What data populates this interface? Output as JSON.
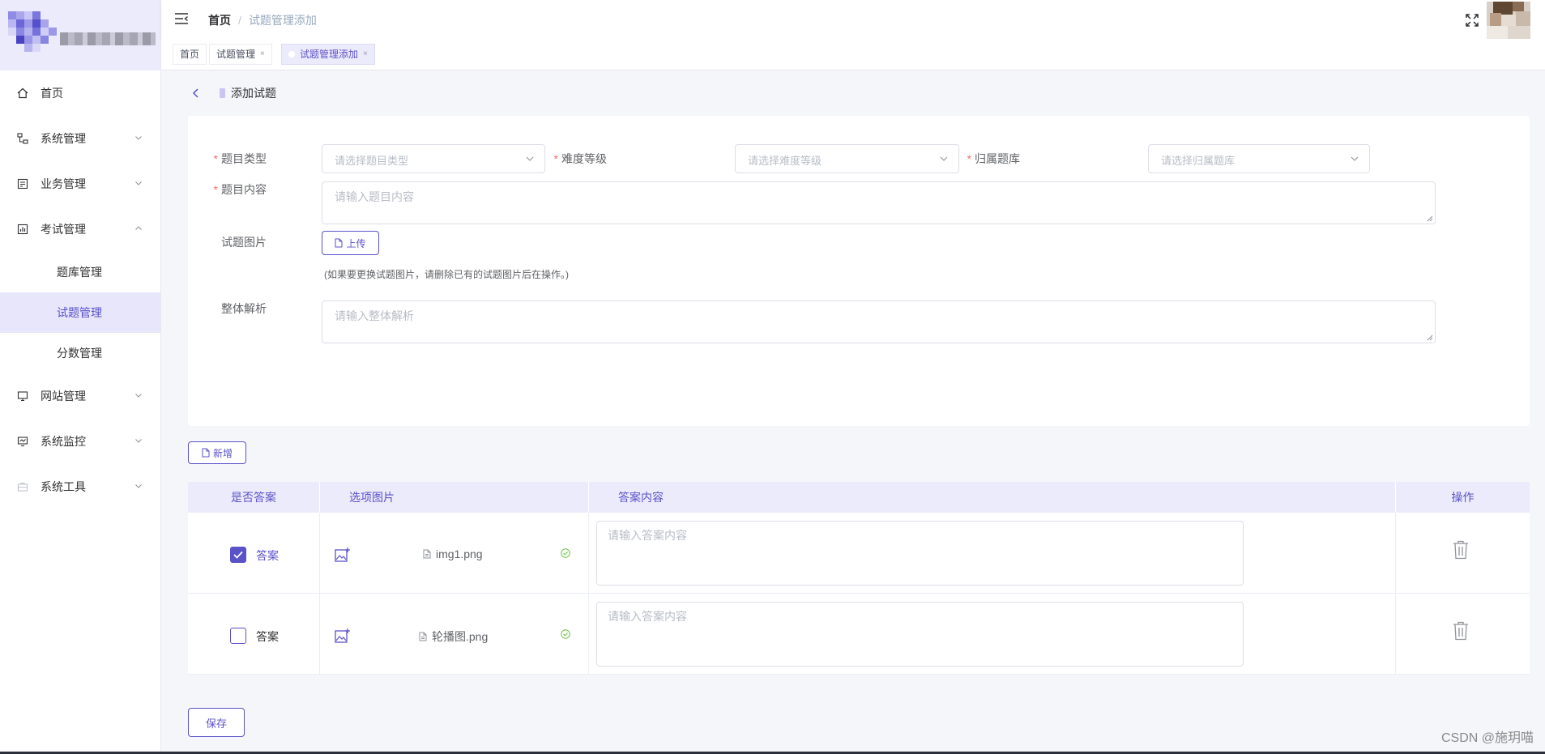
{
  "colors": {
    "accent": "#5a52c9",
    "accent_light": "#ecebfb",
    "required": "#f56c6c",
    "success": "#67c23a"
  },
  "sidebar": {
    "items": [
      {
        "label": "首页",
        "icon": "home-icon"
      },
      {
        "label": "系统管理",
        "icon": "system-settings-icon"
      },
      {
        "label": "业务管理",
        "icon": "business-icon"
      },
      {
        "label": "考试管理",
        "icon": "exam-icon",
        "expanded": true,
        "children": [
          {
            "label": "题库管理"
          },
          {
            "label": "试题管理",
            "active": true
          },
          {
            "label": "分数管理"
          }
        ]
      },
      {
        "label": "网站管理",
        "icon": "website-icon"
      },
      {
        "label": "系统监控",
        "icon": "monitor-icon"
      },
      {
        "label": "系统工具",
        "icon": "tools-icon"
      }
    ]
  },
  "header": {
    "breadcrumb": {
      "home": "首页",
      "separator": "/",
      "current": "试题管理添加"
    }
  },
  "tags": [
    {
      "label": "首页"
    },
    {
      "label": "试题管理",
      "close": "×"
    },
    {
      "label": "试题管理添加",
      "close": "×",
      "active": true
    }
  ],
  "page": {
    "title": "添加试题"
  },
  "form": {
    "question_type": {
      "label": "题目类型",
      "required_mark": "*",
      "placeholder": "请选择题目类型"
    },
    "difficulty": {
      "label": "难度等级",
      "required_mark": "*",
      "placeholder": "请选择难度等级"
    },
    "bank": {
      "label": "归属题库",
      "required_mark": "*",
      "placeholder": "请选择归属题库"
    },
    "content": {
      "label": "题目内容",
      "required_mark": "*",
      "placeholder": "请输入题目内容"
    },
    "image": {
      "label": "试题图片",
      "upload_label": "上传",
      "hint": "(如果要更换试题图片，请删除已有的试题图片后在操作。)"
    },
    "analysis": {
      "label": "整体解析",
      "placeholder": "请输入整体解析"
    }
  },
  "add_button": "新增",
  "table": {
    "headers": [
      "是否答案",
      "选项图片",
      "答案内容",
      "操作"
    ],
    "rows": [
      {
        "checked": true,
        "answer_label": "答案",
        "file": "img1.png",
        "placeholder": "请输入答案内容"
      },
      {
        "checked": false,
        "answer_label": "答案",
        "file": "轮播图.png",
        "placeholder": "请输入答案内容"
      }
    ]
  },
  "save_button": "保存",
  "watermark": "CSDN @施玥喵"
}
